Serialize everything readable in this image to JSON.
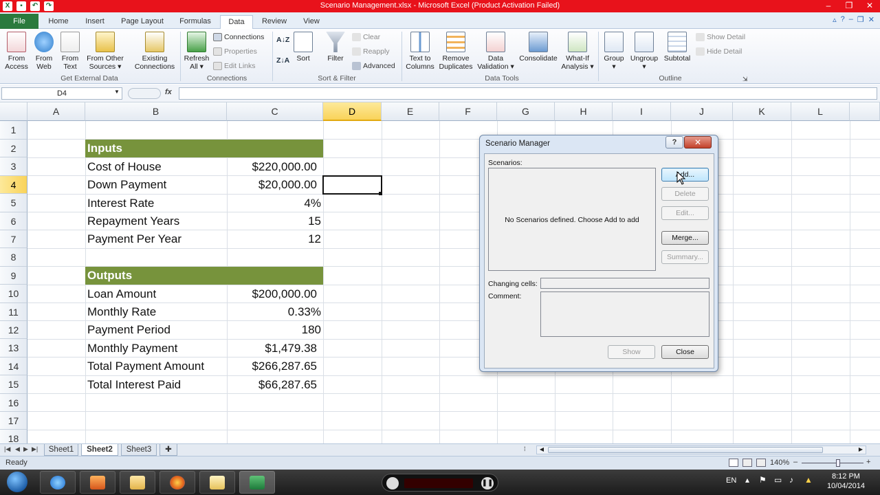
{
  "window": {
    "title": "Scenario Management.xlsx  -  Microsoft Excel (Product Activation Failed)"
  },
  "tabs": [
    "File",
    "Home",
    "Insert",
    "Page Layout",
    "Formulas",
    "Data",
    "Review",
    "View"
  ],
  "active_tab": "Data",
  "ribbon": {
    "get_external": {
      "buttons": [
        {
          "l1": "From",
          "l2": "Access"
        },
        {
          "l1": "From",
          "l2": "Web"
        },
        {
          "l1": "From",
          "l2": "Text"
        },
        {
          "l1": "From Other",
          "l2": "Sources ▾"
        },
        {
          "l1": "Existing",
          "l2": "Connections"
        }
      ],
      "label": "Get External Data"
    },
    "connections": {
      "refresh": {
        "l1": "Refresh",
        "l2": "All ▾"
      },
      "connections": "Connections",
      "properties": "Properties",
      "edit_links": "Edit Links",
      "label": "Connections"
    },
    "sort_filter": {
      "sort": "Sort",
      "filter": "Filter",
      "clear": "Clear",
      "reapply": "Reapply",
      "advanced": "Advanced",
      "label": "Sort & Filter"
    },
    "data_tools": {
      "buttons": [
        {
          "l1": "Text to",
          "l2": "Columns"
        },
        {
          "l1": "Remove",
          "l2": "Duplicates"
        },
        {
          "l1": "Data",
          "l2": "Validation ▾"
        },
        {
          "l1": "Consolidate",
          "l2": ""
        },
        {
          "l1": "What-If",
          "l2": "Analysis ▾"
        }
      ],
      "label": "Data Tools"
    },
    "outline": {
      "group": "Group",
      "ungroup": "Ungroup",
      "subtotal": "Subtotal",
      "show_detail": "Show Detail",
      "hide_detail": "Hide Detail",
      "label": "Outline"
    }
  },
  "formula_bar": {
    "name_box": "D4",
    "fx": "fx",
    "value": ""
  },
  "columns": [
    "A",
    "B",
    "C",
    "D",
    "E",
    "F",
    "G",
    "H",
    "I",
    "J",
    "K",
    "L"
  ],
  "selected_column": "D",
  "rows": [
    "1",
    "2",
    "3",
    "4",
    "5",
    "6",
    "7",
    "8",
    "9",
    "10",
    "11",
    "12",
    "13",
    "14",
    "15",
    "16",
    "17",
    "18"
  ],
  "selected_row": "4",
  "sheet": {
    "inputs_header": "Inputs",
    "inputs": [
      {
        "label": "Cost of House",
        "value": "$220,000.00"
      },
      {
        "label": "Down Payment",
        "value": "$20,000.00"
      },
      {
        "label": "Interest Rate",
        "value": "4%"
      },
      {
        "label": "Repayment Years",
        "value": "15"
      },
      {
        "label": "Payment Per Year",
        "value": "12"
      }
    ],
    "outputs_header": "Outputs",
    "outputs": [
      {
        "label": "Loan Amount",
        "value": "$200,000.00"
      },
      {
        "label": "Monthly Rate",
        "value": "0.33%"
      },
      {
        "label": "Payment Period",
        "value": "180"
      },
      {
        "label": "Monthly Payment",
        "value": "$1,479.38"
      },
      {
        "label": "Total Payment Amount",
        "value": "$266,287.65"
      },
      {
        "label": "Total Interest Paid",
        "value": "$66,287.65"
      }
    ],
    "header_color": "#77933c"
  },
  "sheet_tabs": [
    "Sheet1",
    "Sheet2",
    "Sheet3"
  ],
  "active_sheet": "Sheet2",
  "status": {
    "ready": "Ready",
    "zoom": "140%"
  },
  "dialog": {
    "title": "Scenario Manager",
    "help": "?",
    "close_x": "✕",
    "scenarios_label": "Scenarios:",
    "empty_message": "No Scenarios defined. Choose Add to add scenarios.",
    "buttons": {
      "add": "Add...",
      "delete": "Delete",
      "edit": "Edit...",
      "merge": "Merge...",
      "summary": "Summary..."
    },
    "changing_cells_label": "Changing cells:",
    "comment_label": "Comment:",
    "show": "Show",
    "close": "Close"
  },
  "taskbar": {
    "lang": "EN",
    "time": "8:12 PM",
    "date": "10/04/2014"
  }
}
